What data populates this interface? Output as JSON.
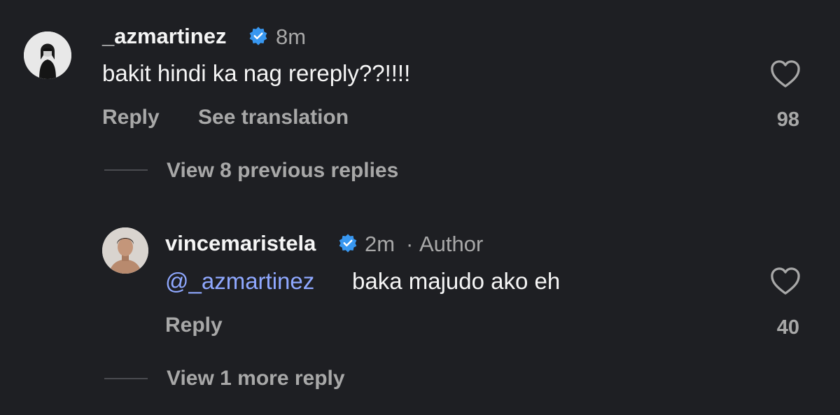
{
  "comment": {
    "username": "_azmartinez",
    "verified_icon": "verified-badge-icon",
    "time": "8m",
    "text": "bakit hindi ka nag rereply??!!!!",
    "reply_label": "Reply",
    "translate_label": "See translation",
    "likes": "98",
    "like_icon": "heart-icon",
    "view_previous_label": "View 8 previous replies"
  },
  "reply": {
    "username": "vincemaristela",
    "verified_icon": "verified-badge-icon",
    "time": "2m",
    "separator": "·",
    "author_tag": "Author",
    "mention": "@_azmartinez",
    "text": "baka majudo ako eh",
    "reply_label": "Reply",
    "likes": "40",
    "like_icon": "heart-icon",
    "view_more_label": "View 1 more reply"
  },
  "colors": {
    "background": "#1e1f23",
    "text_primary": "#f5f5f5",
    "text_secondary": "#a8a8a8",
    "mention": "#8fa8ff",
    "verified": "#3897f0"
  }
}
